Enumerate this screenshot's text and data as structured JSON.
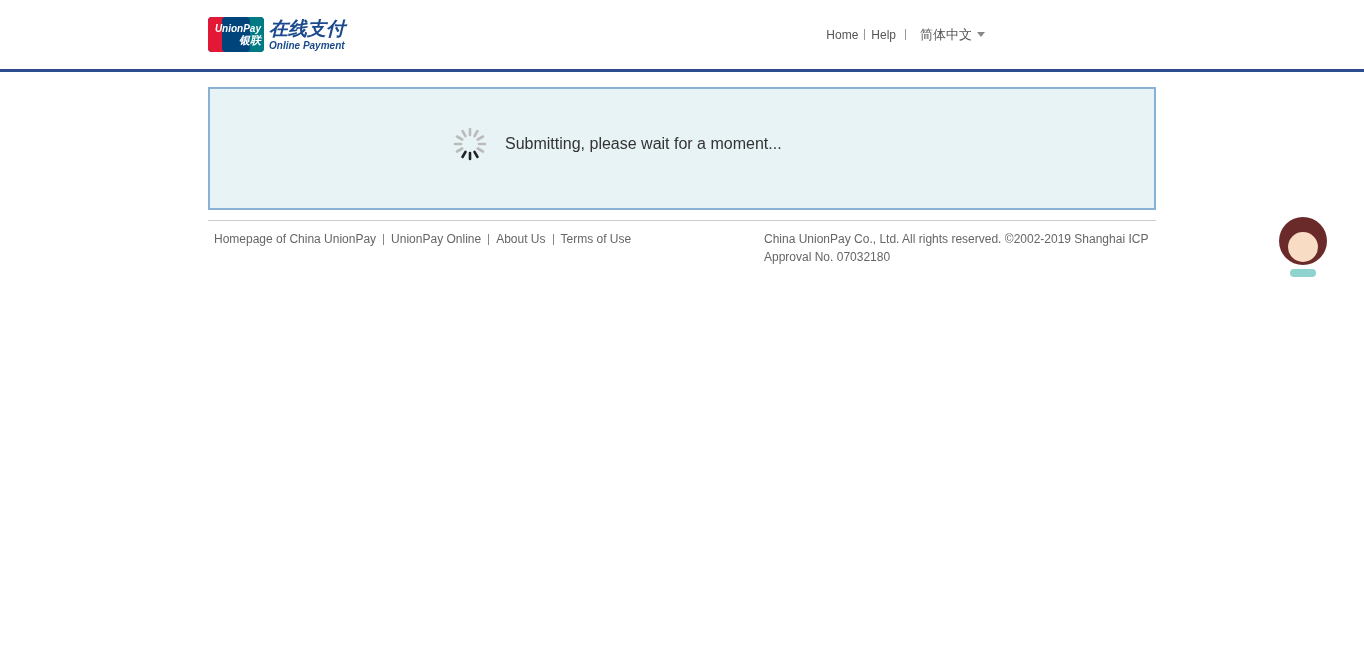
{
  "logo": {
    "card_text": "UnionPay",
    "card_subtext": "银联",
    "title": "在线支付",
    "subtitle": "Online Payment"
  },
  "nav": {
    "links": [
      "Home",
      "Help"
    ],
    "language": "简体中文"
  },
  "status": {
    "message": "Submitting, please wait for a moment..."
  },
  "footer": {
    "links": [
      "Homepage of China UnionPay",
      "UnionPay Online",
      "About Us",
      "Terms of Use"
    ],
    "copyright": "China UnionPay Co., Ltd. All rights reserved. ©2002-2019 Shanghai ICP Approval No. 07032180"
  }
}
